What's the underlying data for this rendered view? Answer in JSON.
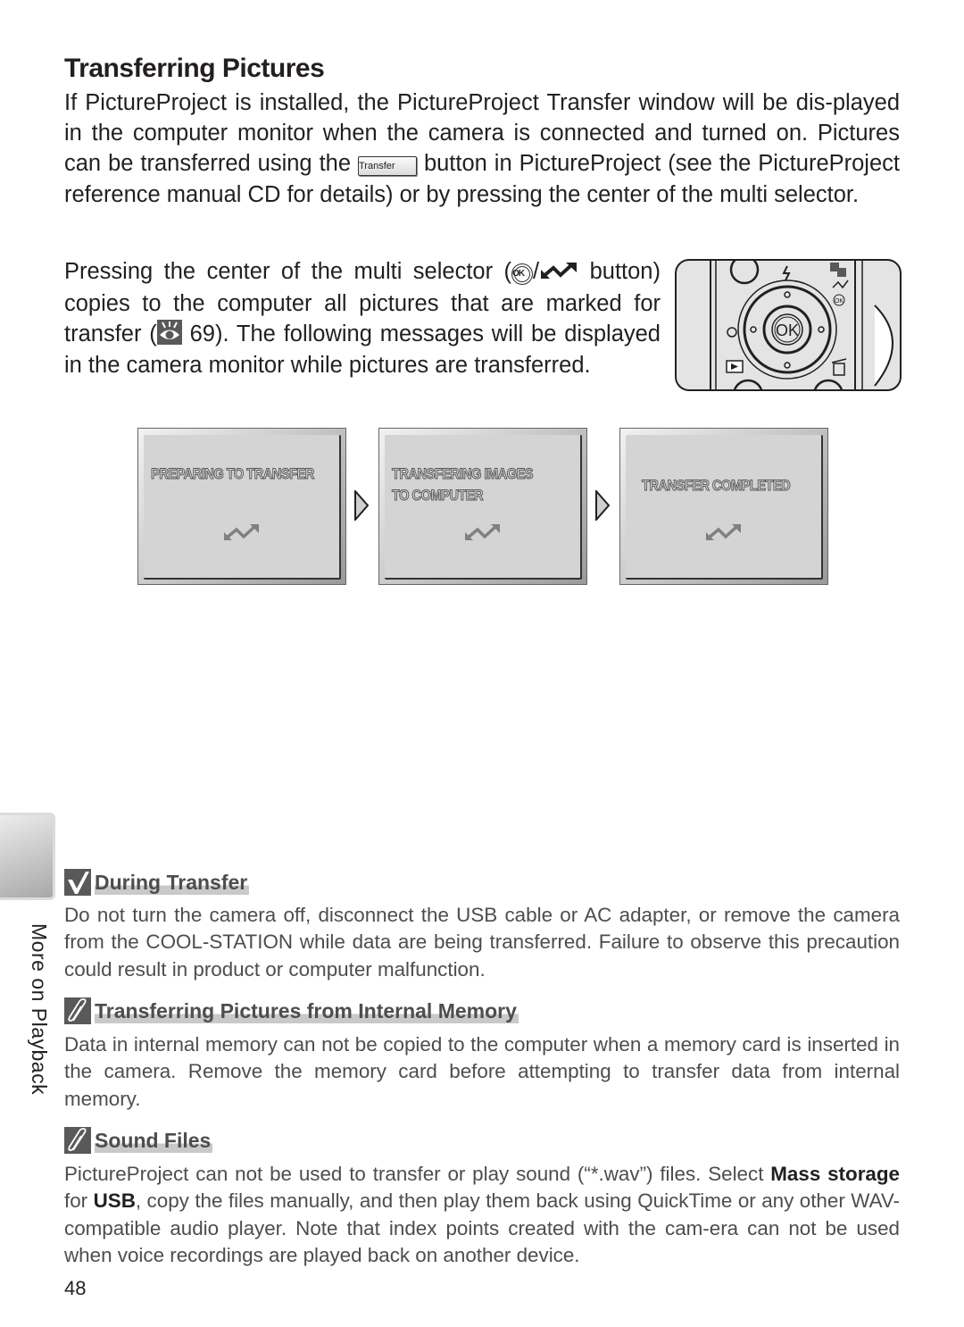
{
  "page": {
    "title": "Transferring Pictures",
    "intro": {
      "before_button": "If PictureProject is installed, the PictureProject Transfer window will be dis-played in the computer monitor when the camera is connected and turned on.  Pictures can be transferred using the ",
      "button_label": "Transfer",
      "after_button": " button in PictureProject (see the PictureProject reference manual CD for details) or by pressing the center of the multi selector."
    },
    "selector_para": {
      "part1": "Pressing the center of the multi selector (",
      "ok_label": "OK",
      "part2": " button) copies to the computer all pictures that are marked for transfer (",
      "page_ref": " 69).  The following messages will be displayed in the camera monitor while pictures are transferred."
    },
    "camera": {
      "center_label": "OK",
      "small_ok_label": "OK"
    },
    "screens": [
      {
        "line1": "PREPARING TO TRANSFER",
        "line2": ""
      },
      {
        "line1": "TRANSFERING IMAGES",
        "line2": "TO COMPUTER"
      },
      {
        "line1": "TRANSFER COMPLETED",
        "line2": ""
      }
    ],
    "side_tab_label": "More on Playback",
    "notes": [
      {
        "icon": "check-icon",
        "title": "During Transfer",
        "body": "Do not turn the camera off, disconnect the USB cable or AC adapter, or remove the camera from the COOL-STATION while data are being transferred.  Failure to observe this precaution could result in product or computer malfunction."
      },
      {
        "icon": "paperclip-icon",
        "title": "Transferring Pictures from Internal Memory",
        "body": "Data in internal memory can not be copied to the computer when a memory card is inserted in the camera.  Remove the memory card before attempting to transfer data from internal memory."
      },
      {
        "icon": "paperclip-icon",
        "title": "Sound Files",
        "body_parts": {
          "t1": "PictureProject can not be used to transfer or play sound (“*.wav”) files.  Select ",
          "b1": "Mass storage",
          "t2": " for ",
          "b2": "USB",
          "t3": ", copy the files manually, and then play them back using QuickTime or any other WAV-compatible audio player.  Note that index points created with the cam-era can not be used when voice recordings are played back on another device."
        }
      }
    ],
    "page_number": "48"
  }
}
